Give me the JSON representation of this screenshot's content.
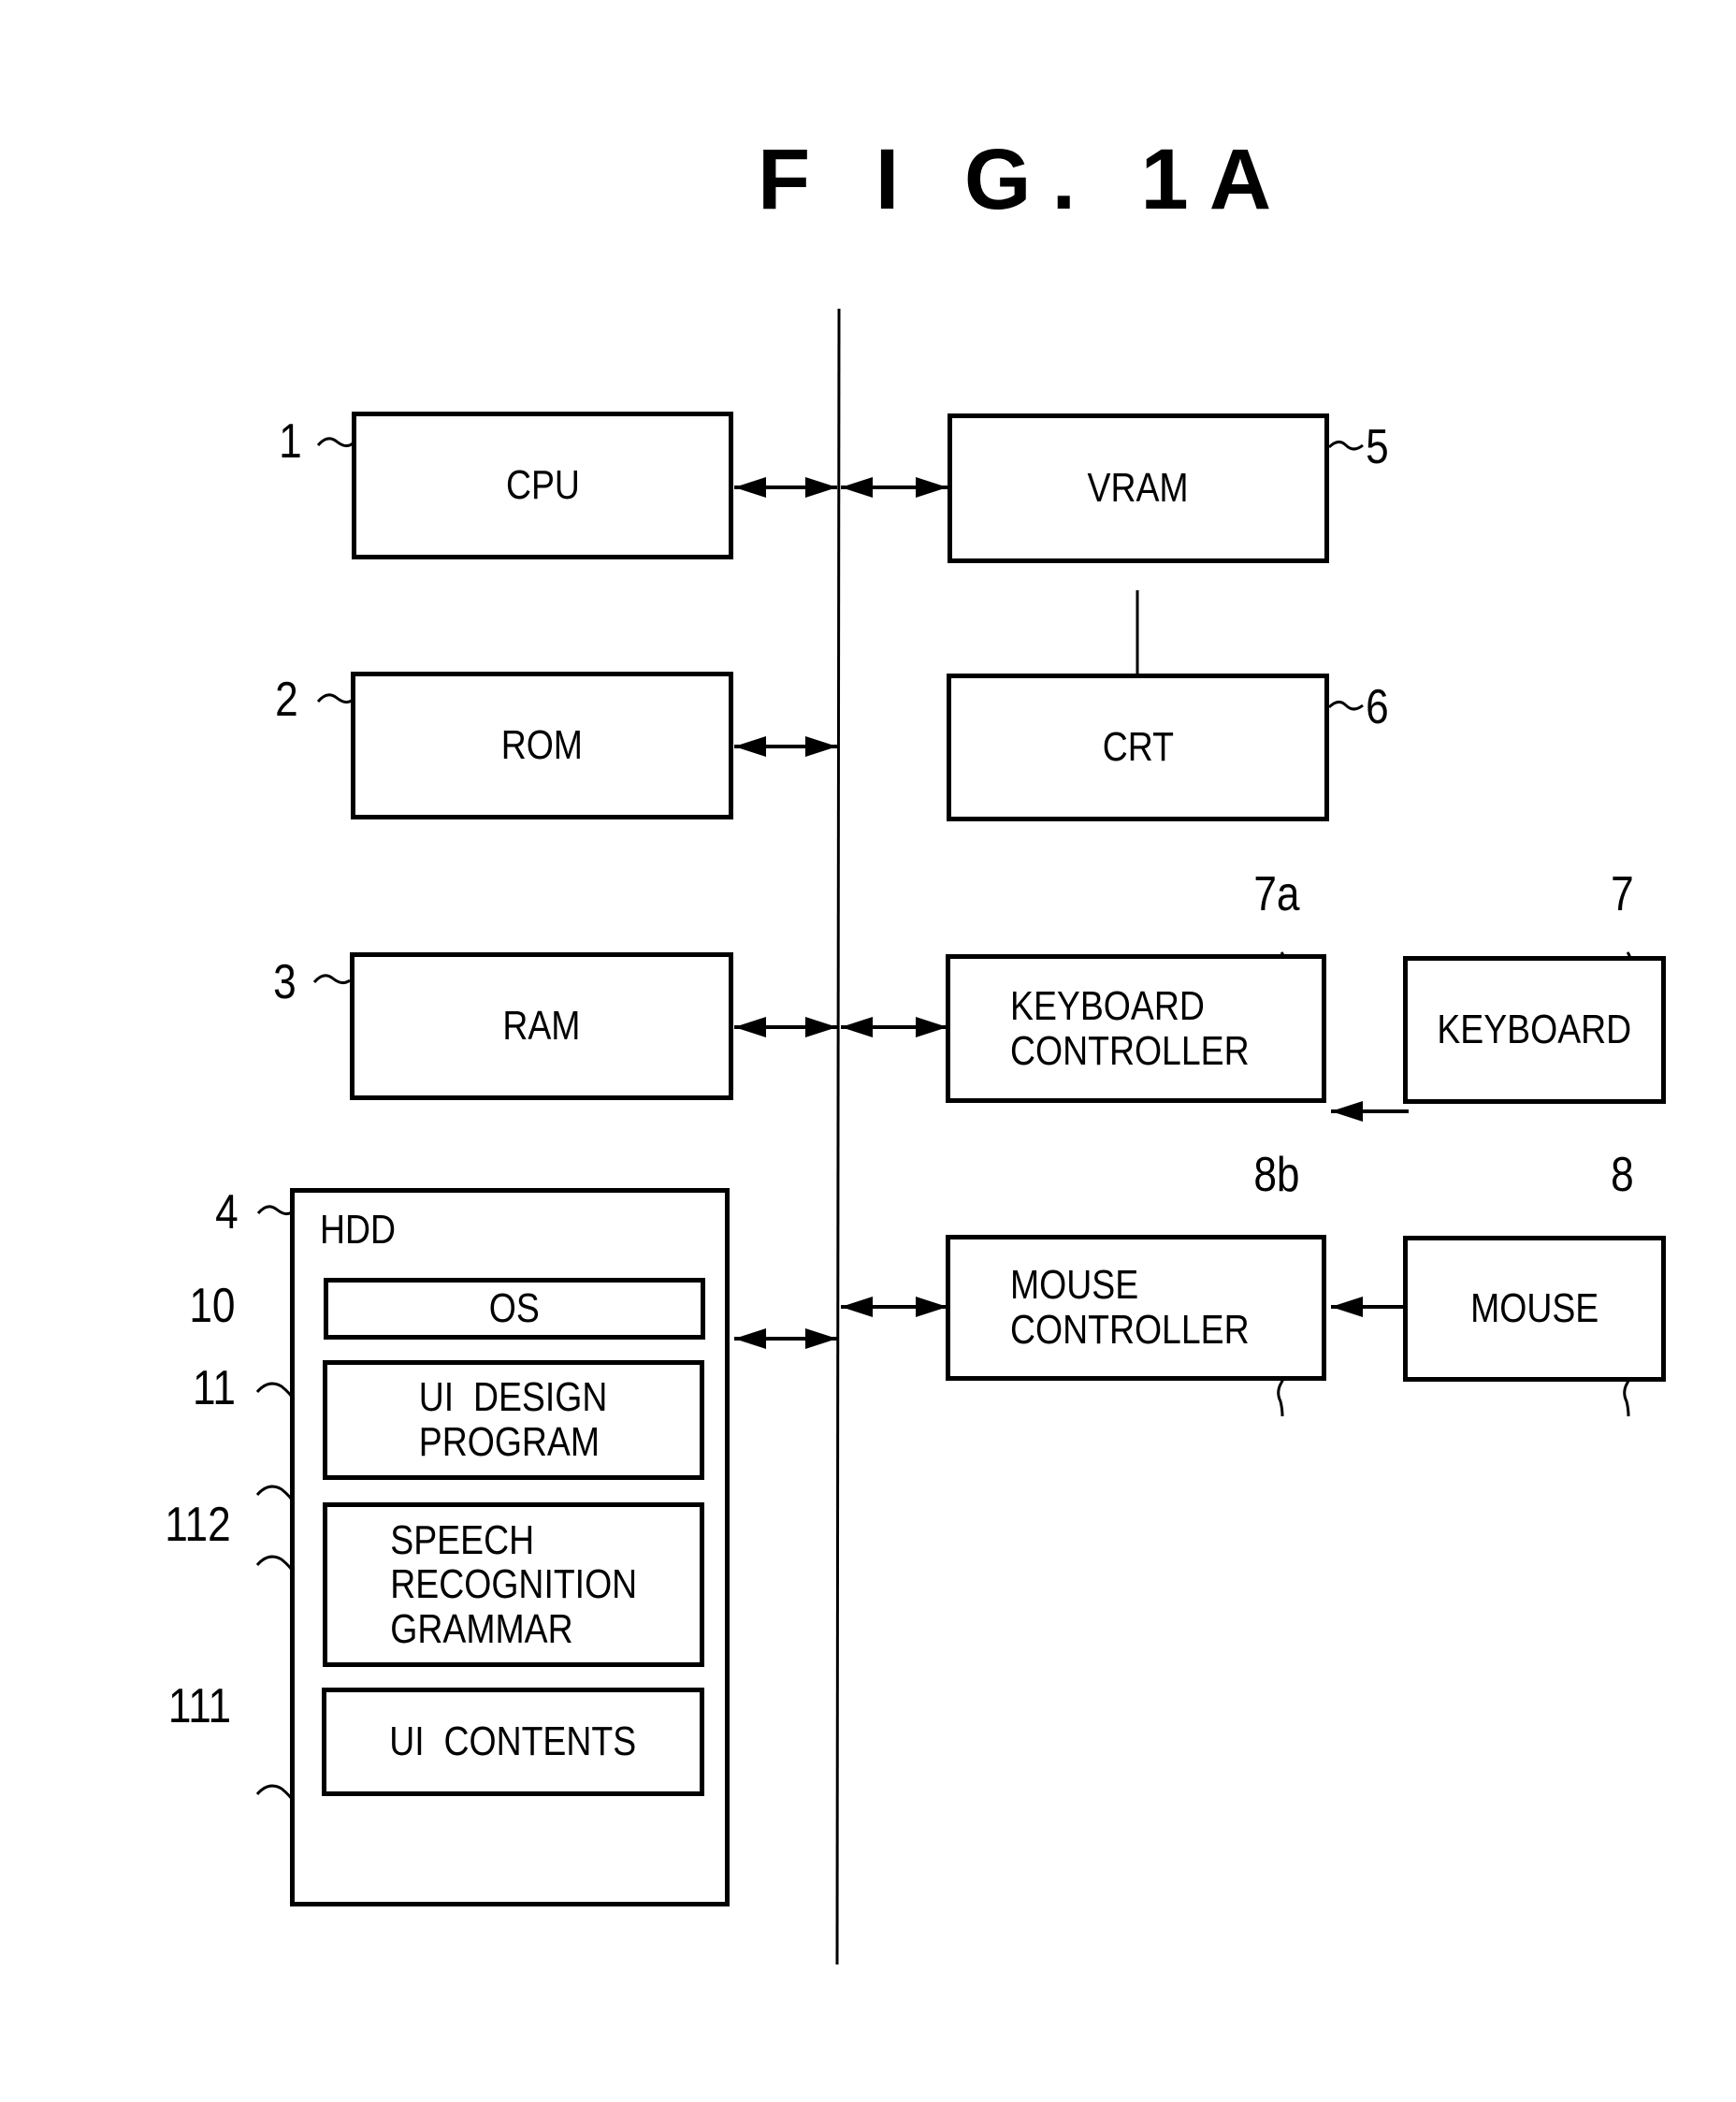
{
  "figure": {
    "title": "F I G.  1A"
  },
  "blocks": {
    "cpu": {
      "label": "CPU",
      "ref": "1"
    },
    "rom": {
      "label": "ROM",
      "ref": "2"
    },
    "ram": {
      "label": "RAM",
      "ref": "3"
    },
    "hdd": {
      "label": "HDD",
      "ref": "4"
    },
    "os": {
      "label": "OS",
      "ref": "10"
    },
    "ui_design_program": {
      "label": "UI  DESIGN\nPROGRAM",
      "ref": "11"
    },
    "speech_recognition_grammar": {
      "label": "SPEECH\nRECOGNITION\nGRAMMAR",
      "ref": "112"
    },
    "ui_contents": {
      "label": "UI  CONTENTS",
      "ref": "111"
    },
    "vram": {
      "label": "VRAM",
      "ref": "5"
    },
    "crt": {
      "label": "CRT",
      "ref": "6"
    },
    "keyboard_controller": {
      "label": "KEYBOARD\nCONTROLLER",
      "ref": "7a"
    },
    "keyboard": {
      "label": "KEYBOARD",
      "ref": "7"
    },
    "mouse_controller": {
      "label": "MOUSE\nCONTROLLER",
      "ref": "8b"
    },
    "mouse": {
      "label": "MOUSE",
      "ref": "8"
    }
  },
  "connections": [
    {
      "from": "cpu",
      "to": "bus",
      "type": "bidirectional"
    },
    {
      "from": "rom",
      "to": "bus",
      "type": "bidirectional"
    },
    {
      "from": "ram",
      "to": "bus",
      "type": "bidirectional"
    },
    {
      "from": "hdd",
      "to": "bus",
      "type": "bidirectional"
    },
    {
      "from": "bus",
      "to": "vram",
      "type": "bidirectional"
    },
    {
      "from": "vram",
      "to": "crt",
      "type": "directed"
    },
    {
      "from": "bus",
      "to": "keyboard_controller",
      "type": "bidirectional"
    },
    {
      "from": "keyboard",
      "to": "keyboard_controller",
      "type": "directed"
    },
    {
      "from": "bus",
      "to": "mouse_controller",
      "type": "bidirectional"
    },
    {
      "from": "mouse",
      "to": "mouse_controller",
      "type": "directed"
    }
  ]
}
